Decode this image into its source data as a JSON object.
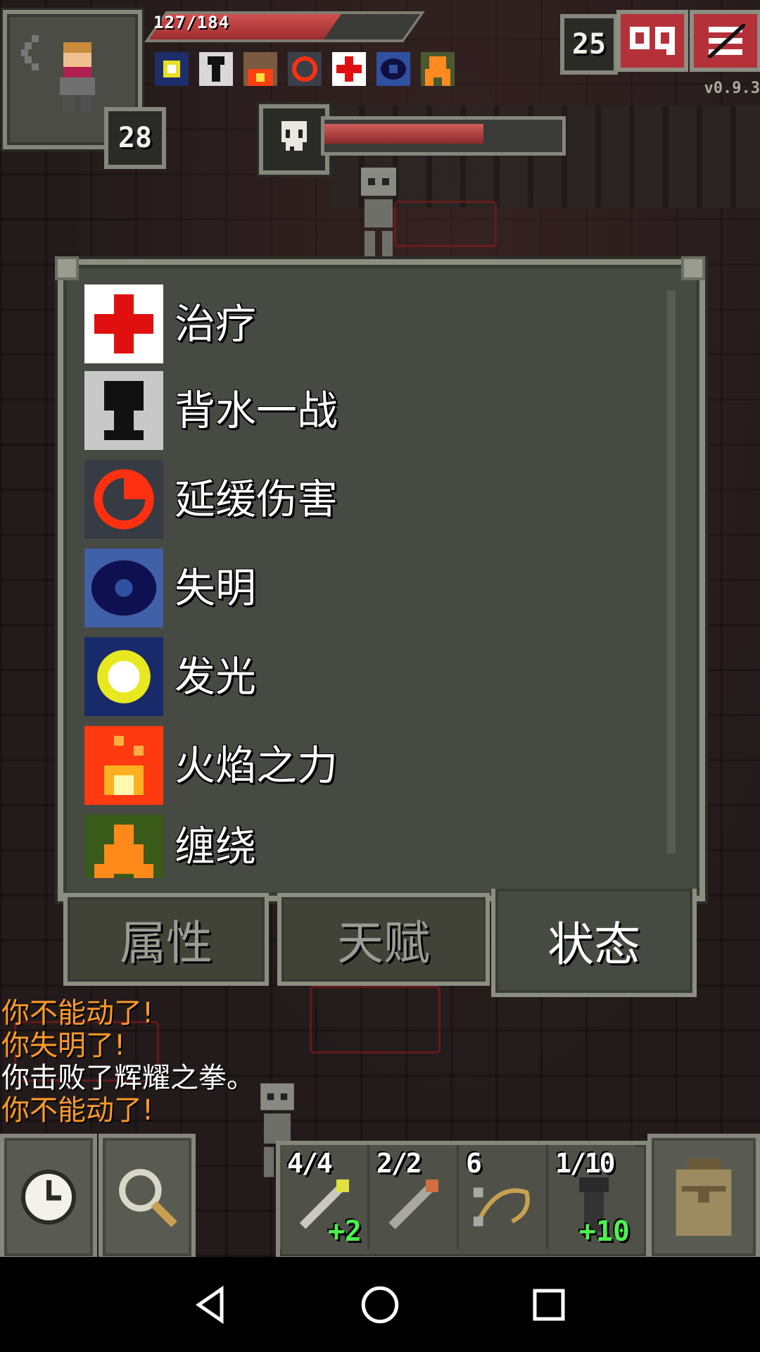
{
  "hud": {
    "hp_text": "127/184",
    "hp_fraction": 0.69,
    "hero_level": "28",
    "depth": "25",
    "version": "v0.9.3",
    "boss_hp_fraction": 0.67,
    "buff_icons": [
      "glow-icon",
      "berserk-icon",
      "fire-icon",
      "delayed-damage-icon",
      "healing-icon",
      "blind-icon",
      "rooted-icon"
    ]
  },
  "panel": {
    "buffs": [
      {
        "label": "治疗",
        "icon": "healing-icon"
      },
      {
        "label": "背水一战",
        "icon": "keyhole-icon"
      },
      {
        "label": "延缓伤害",
        "icon": "delayed-damage-icon"
      },
      {
        "label": "失明",
        "icon": "blind-eye-icon"
      },
      {
        "label": "发光",
        "icon": "glow-icon"
      },
      {
        "label": "火焰之力",
        "icon": "fire-icon"
      },
      {
        "label": "缠绕",
        "icon": "rooted-icon"
      }
    ],
    "tabs": [
      {
        "label": "属性",
        "active": false
      },
      {
        "label": "天赋",
        "active": false
      },
      {
        "label": "状态",
        "active": true
      }
    ]
  },
  "log": [
    {
      "text": "你不能动了!",
      "style": "warn"
    },
    {
      "text": "你失明了!",
      "style": "warn"
    },
    {
      "text": "你击败了辉耀之拳。",
      "style": "normal"
    },
    {
      "text": "你不能动了!",
      "style": "warn"
    }
  ],
  "quickslots": [
    {
      "count": "4/4",
      "level": "+2",
      "icon": "wand-icon"
    },
    {
      "count": "2/2",
      "level": "",
      "icon": "wand-icon"
    },
    {
      "count": "6",
      "level": "",
      "icon": "bolas-icon"
    },
    {
      "count": "1/10",
      "level": "+10",
      "icon": "horn-icon"
    }
  ],
  "colors": {
    "accent_red": "#b4313a",
    "warn_text": "#ff9a2a",
    "level_green": "#4cf24c"
  }
}
